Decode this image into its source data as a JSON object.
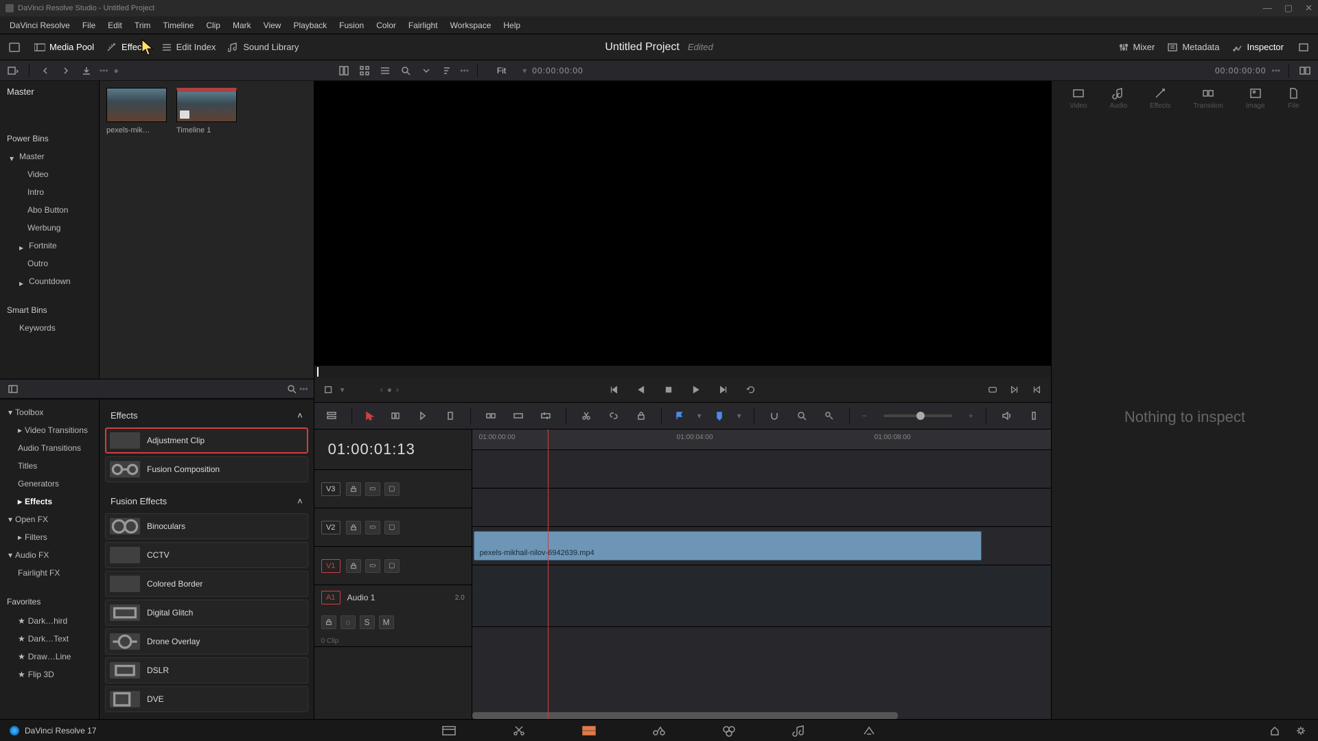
{
  "window": {
    "title": "DaVinci Resolve Studio - Untitled Project"
  },
  "menu": [
    "DaVinci Resolve",
    "File",
    "Edit",
    "Trim",
    "Timeline",
    "Clip",
    "Mark",
    "View",
    "Playback",
    "Fusion",
    "Color",
    "Fairlight",
    "Workspace",
    "Help"
  ],
  "workbar": {
    "media_pool": "Media Pool",
    "effects": "Effects",
    "edit_index": "Edit Index",
    "sound_library": "Sound Library",
    "project_name": "Untitled Project",
    "project_status": "Edited",
    "mixer": "Mixer",
    "metadata": "Metadata",
    "inspector": "Inspector"
  },
  "sectoolbar": {
    "fit": "Fit",
    "tc_left": "00:00:00:00",
    "tc_right": "00:00:00:00"
  },
  "mediapool": {
    "master": "Master",
    "power_bins": "Power Bins",
    "bins": [
      "Master",
      "Video",
      "Intro",
      "Abo Button",
      "Werbung",
      "Fortnite",
      "Outro",
      "Countdown"
    ],
    "smart_bins": "Smart Bins",
    "smart_items": [
      "Keywords"
    ],
    "thumbs": [
      {
        "name": "pexels-mik…"
      },
      {
        "name": "Timeline 1"
      }
    ]
  },
  "fxtree": {
    "toolbox": "Toolbox",
    "items1": [
      "Video Transitions",
      "Audio Transitions",
      "Titles",
      "Generators",
      "Effects"
    ],
    "open_fx": "Open FX",
    "filters": "Filters",
    "audio_fx": "Audio FX",
    "fairlight": "Fairlight FX",
    "favorites": "Favorites",
    "favs": [
      "Dark…hird",
      "Dark…Text",
      "Draw…Line",
      "Flip 3D"
    ]
  },
  "fxlist": {
    "h1": "Effects",
    "h2": "Fusion Effects",
    "group1": [
      "Adjustment Clip",
      "Fusion Composition"
    ],
    "group2": [
      "Binoculars",
      "CCTV",
      "Colored Border",
      "Digital Glitch",
      "Drone Overlay",
      "DSLR",
      "DVE"
    ]
  },
  "timeline": {
    "tc": "01:00:01:13",
    "ruler": [
      "01:00:00:00",
      "01:00:04:00",
      "01:00:08:00"
    ],
    "tracks": {
      "v3": "V3",
      "v2": "V2",
      "v1": "V1",
      "a1": "A1",
      "audio1": "Audio 1",
      "a1_ch": "2.0",
      "a1_sub": "0 Clip"
    },
    "clip_name": "pexels-mikhail-nilov-6942639.mp4"
  },
  "inspector": {
    "tabs": [
      "Video",
      "Audio",
      "Effects",
      "Transition",
      "Image",
      "File"
    ],
    "empty": "Nothing to inspect"
  },
  "footer": {
    "brand": "DaVinci Resolve 17"
  },
  "icons": {
    "s": "S",
    "m": "M"
  }
}
